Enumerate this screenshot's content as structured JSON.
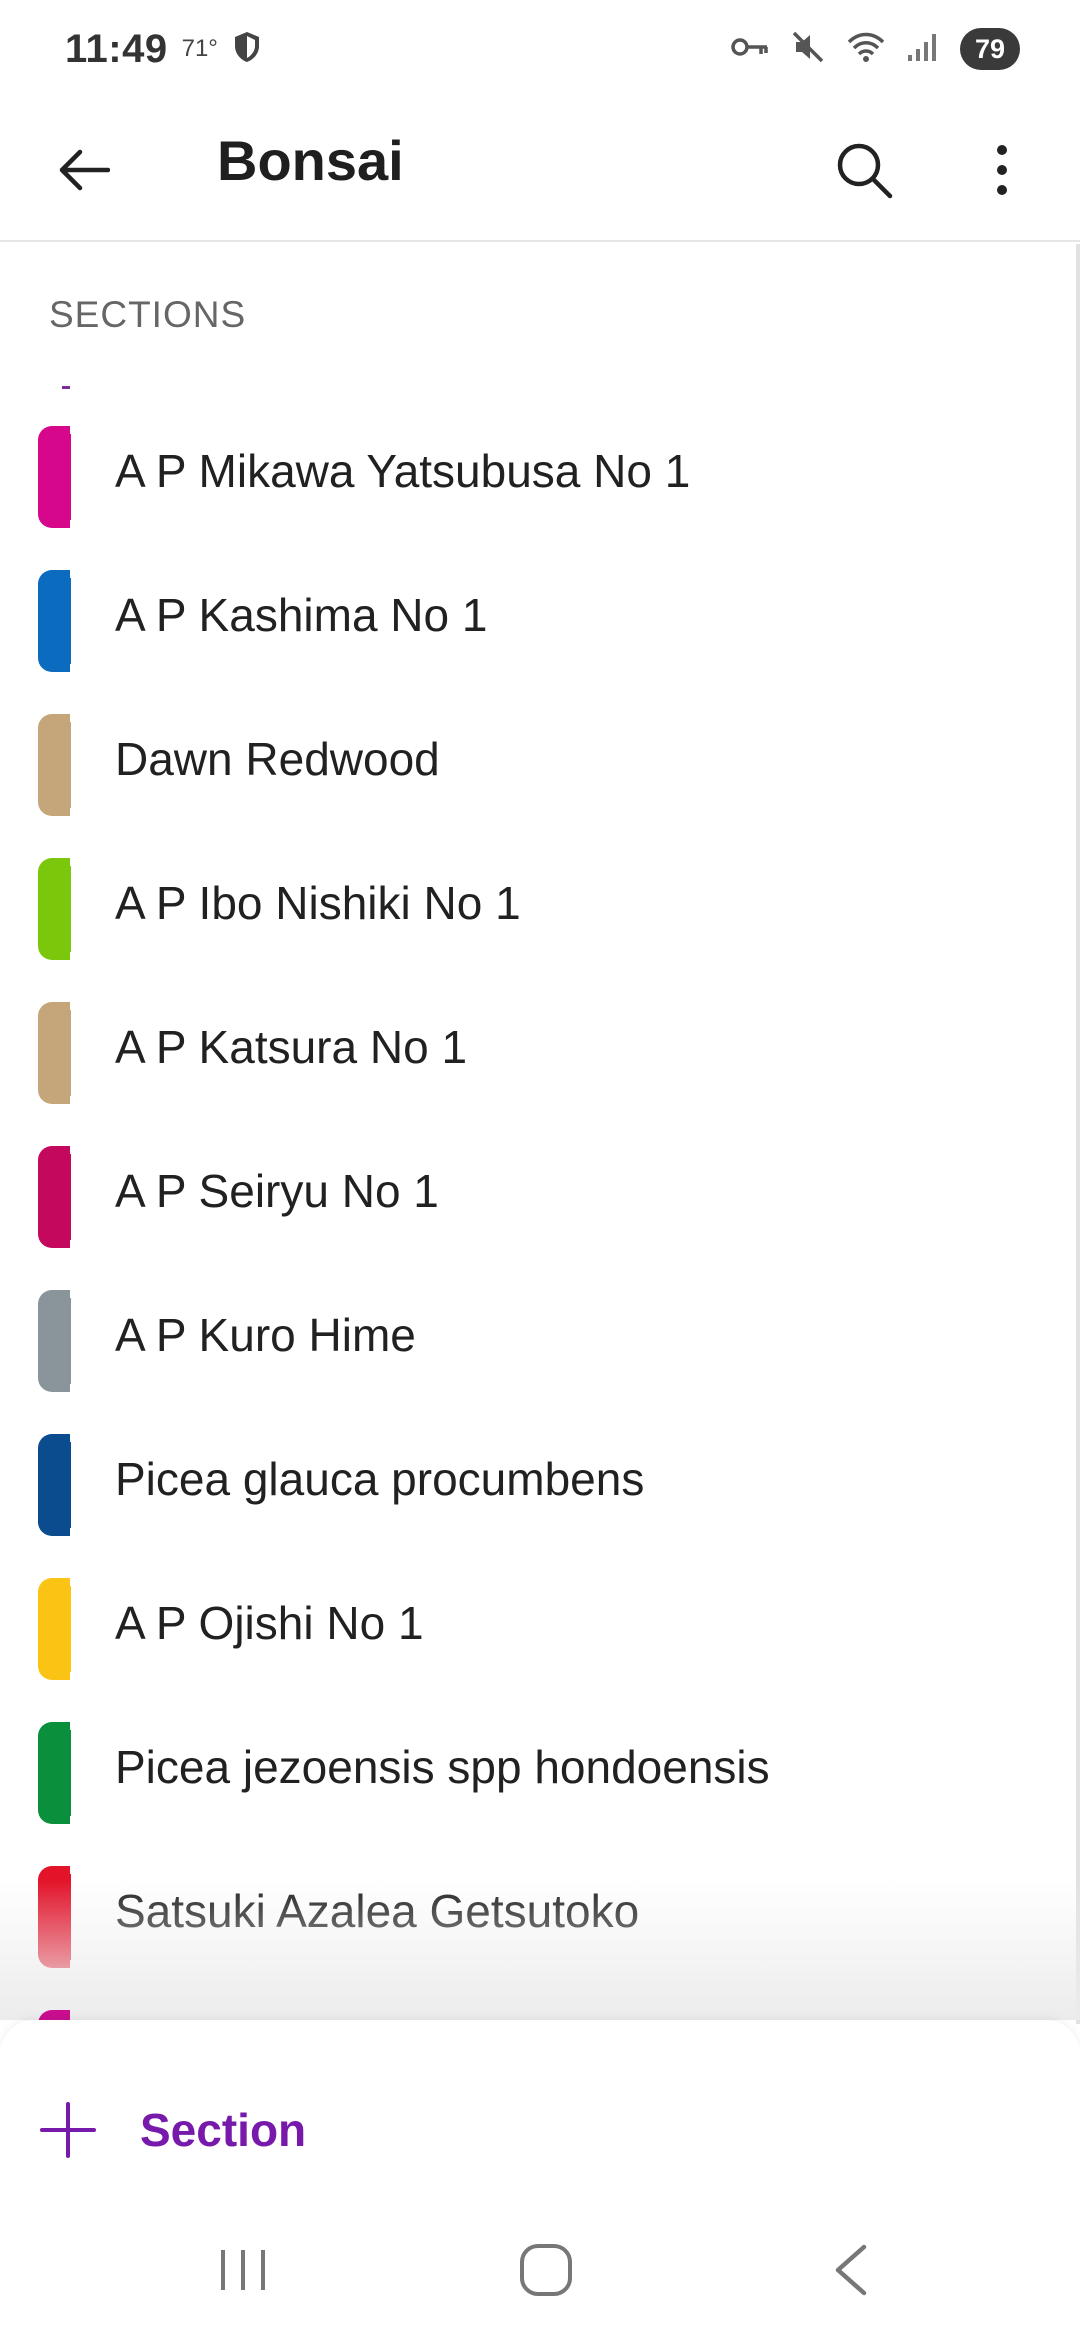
{
  "status_bar": {
    "time": "11:49",
    "temperature": "71°",
    "battery": "79"
  },
  "app_bar": {
    "title": "Bonsai"
  },
  "sections": {
    "header": "SECTIONS",
    "items": [
      {
        "label": "A P Mikawa Yatsubusa No 1",
        "color": "#d6078b"
      },
      {
        "label": "A P Kashima No 1",
        "color": "#0a6bbf"
      },
      {
        "label": "Dawn Redwood",
        "color": "#c4a67a"
      },
      {
        "label": "A P Ibo Nishiki No 1",
        "color": "#7ac70c"
      },
      {
        "label": "A P Katsura No 1",
        "color": "#c4a67a"
      },
      {
        "label": "A P Seiryu No 1",
        "color": "#c4085e"
      },
      {
        "label": "A P Kuro Hime",
        "color": "#8a959b"
      },
      {
        "label": "Picea glauca procumbens",
        "color": "#0b4c8f"
      },
      {
        "label": "A P Ojishi No 1",
        "color": "#fbc313"
      },
      {
        "label": "Picea jezoensis spp hondoensis",
        "color": "#0a8f3c"
      },
      {
        "label": "Satsuki Azalea Getsutoko",
        "color": "#e3132a"
      }
    ]
  },
  "bottom_sheet": {
    "add_label": "Section",
    "accent": "#7719aa"
  }
}
